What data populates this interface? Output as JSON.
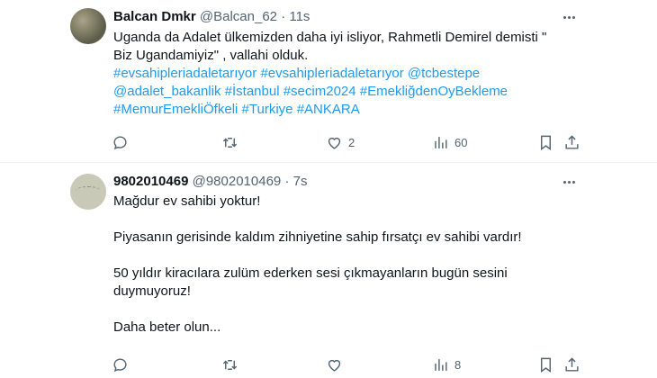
{
  "tweets": [
    {
      "name": "Balcan Dmkr",
      "handle": "@Balcan_62",
      "separator": "·",
      "time": "11s",
      "text": "Uganda da Adalet ülkemizden daha iyi isliyor, Rahmetli Demirel demisti \" Biz Ugandamiyiz\" , vallahi olduk.",
      "hashtags": [
        "#evsahipleriadaletarıyor",
        "#evsahipleriadaletarıyor",
        "@tcbestepe",
        "@adalet_bakanlik",
        "#İstanbul",
        "#secim2024",
        "#EmekliğdenOyBekleme",
        "#MemurEmekliÖfkeli",
        "#Turkiye",
        "#ANKARA"
      ],
      "reply_count": "",
      "retweet_count": "",
      "like_count": "2",
      "view_count": "60"
    },
    {
      "name": "9802010469",
      "handle": "@9802010469",
      "separator": "·",
      "time": "7s",
      "paragraphs": [
        "Mağdur ev sahibi yoktur!",
        "Piyasanın gerisinde kaldım zihniyetine sahip fırsatçı ev sahibi vardır!",
        "50 yıldır kiracılara zulüm ederken sesi çıkmayanların bugün sesini duymuyoruz!",
        "Daha beter olun..."
      ],
      "reply_count": "",
      "retweet_count": "",
      "like_count": "",
      "view_count": "8"
    }
  ]
}
